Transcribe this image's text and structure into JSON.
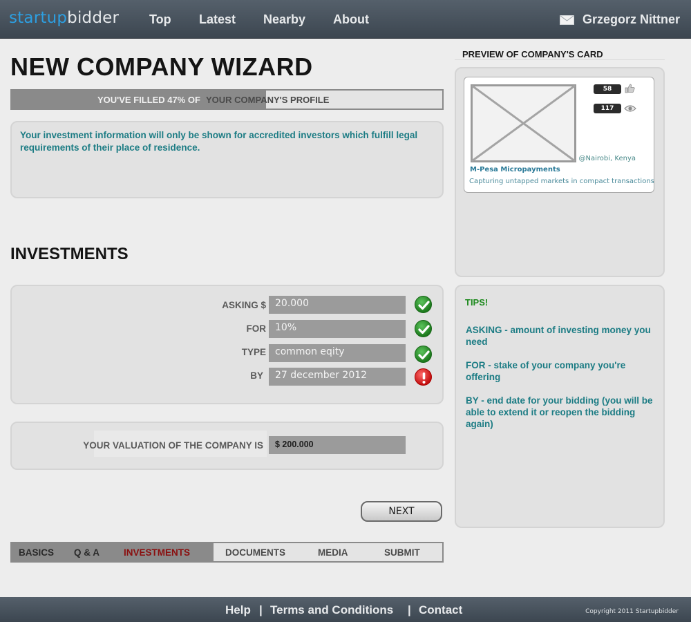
{
  "header": {
    "logo_part1": "startup",
    "logo_part2": "bidder",
    "nav": [
      "Top",
      "Latest",
      "Nearby",
      "About"
    ],
    "user_name": "Grzegorz Nittner"
  },
  "wizard": {
    "title": "NEW COMPANY WIZARD",
    "progress": {
      "fraction": 0.47,
      "label_filled": "YOU'VE FILLED 47% OF",
      "label_rest": "YOUR COMPANY'S PROFILE"
    },
    "info": "Your investment information will only be shown for accredited investors which fulfill legal requirements of their place of residence.",
    "section_title": "INVESTMENTS",
    "fields": [
      {
        "label": "ASKING $",
        "value": "20.000",
        "status": "ok"
      },
      {
        "label": "FOR",
        "value": "10%",
        "status": "ok"
      },
      {
        "label": "TYPE",
        "value": "common eqity",
        "status": "ok"
      },
      {
        "label": "BY",
        "value": "27 december 2012",
        "status": "error"
      }
    ],
    "valuation_label": "YOUR VALUATION OF THE COMPANY IS",
    "valuation_value": "$ 200.000",
    "next_button": "NEXT",
    "steps": [
      {
        "label": "BASICS",
        "state": "done"
      },
      {
        "label": "Q & A",
        "state": "done"
      },
      {
        "label": "INVESTMENTS",
        "state": "active"
      },
      {
        "label": "DOCUMENTS",
        "state": "todo"
      },
      {
        "label": "MEDIA",
        "state": "todo"
      },
      {
        "label": "SUBMIT",
        "state": "todo"
      }
    ]
  },
  "preview": {
    "title": "PREVIEW OF COMPANY'S CARD",
    "likes": "58",
    "views": "117",
    "location": "@Nairobi, Kenya",
    "company_name": "M-Pesa Micropayments",
    "description": "Capturing untapped markets in compact transactions"
  },
  "tips": {
    "title": "TIPS!",
    "items": [
      "ASKING - amount of investing money you need",
      "FOR - stake of your company you're offering",
      "BY - end date for your bidding (you will be able to extend it or reopen the bidding again)"
    ]
  },
  "footer": {
    "links": [
      "Help",
      "Terms and Conditions",
      "Contact"
    ],
    "separator": "|",
    "copyright": "Copyright 2011 Startupbidder"
  },
  "colors": {
    "accent_blue": "#2d9ee0",
    "tip_teal": "#1c7c84",
    "active_step": "#8a0f0f",
    "ok_green": "#1d7a1d",
    "error_red": "#c41010"
  }
}
